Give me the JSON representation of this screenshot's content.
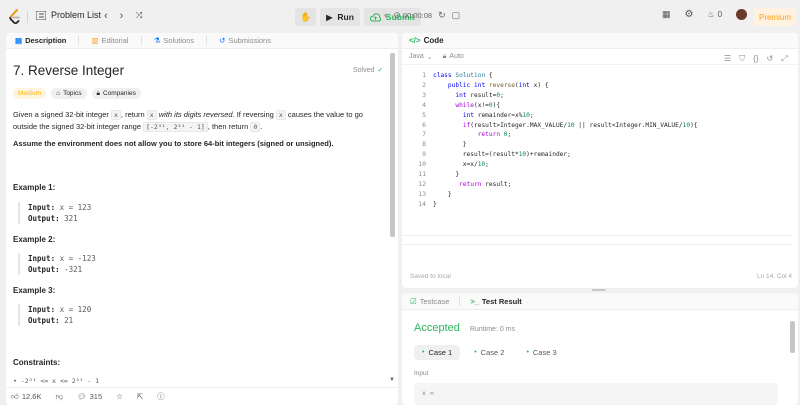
{
  "topbar": {
    "problem_list": "Problem List",
    "run": "Run",
    "submit": "Submit",
    "timer": "00:00:08",
    "coins": "0",
    "premium": "Premium"
  },
  "left_tabs": [
    {
      "label": "Description"
    },
    {
      "label": "Editorial"
    },
    {
      "label": "Solutions"
    },
    {
      "label": "Submissions"
    }
  ],
  "problem": {
    "title": "7. Reverse Integer",
    "solved": "Solved",
    "difficulty": "Medium",
    "topics": "Topics",
    "companies": "Companies",
    "desc_p1a": "Given a signed 32-bit integer ",
    "desc_x": "x",
    "desc_p1b": ", return ",
    "desc_p1c": " with its digits reversed",
    "desc_p1d": ". If reversing ",
    "desc_p1e": " causes the value to go outside the signed 32-bit integer range ",
    "desc_range": "[-2³¹, 2³¹ - 1]",
    "desc_p1f": ", then return ",
    "desc_zero": "0",
    "desc_p1g": ".",
    "assume": "Assume the environment does not allow you to store 64-bit integers (signed or unsigned).",
    "examples": [
      {
        "heading": "Example 1:",
        "input_label": "Input:",
        "input": "x = 123",
        "output_label": "Output:",
        "output": "321"
      },
      {
        "heading": "Example 2:",
        "input_label": "Input:",
        "input": "x = -123",
        "output_label": "Output:",
        "output": "-321"
      },
      {
        "heading": "Example 3:",
        "input_label": "Input:",
        "input": "x = 120",
        "output_label": "Output:",
        "output": "21"
      }
    ],
    "constraints_heading": "Constraints:",
    "constraint_1": "-2³¹ <= x <= 2³¹ - 1"
  },
  "footer": {
    "likes": "12.6K",
    "comments": "315"
  },
  "code_panel": {
    "title": "Code",
    "language": "Java",
    "auto": "Auto",
    "saved": "Saved to local",
    "cursor": "Ln 14, Col 4"
  },
  "code_lines": [
    "1",
    "2",
    "3",
    "4",
    "5",
    "6",
    "7",
    "8",
    "9",
    "10",
    "11",
    "12",
    "13",
    "14"
  ],
  "result_tabs": {
    "testcase": "Testcase",
    "test_result": "Test Result"
  },
  "result": {
    "status": "Accepted",
    "runtime": "Runtime: 0 ms",
    "cases": [
      "Case 1",
      "Case 2",
      "Case 3"
    ],
    "input_label": "Input",
    "input_value": "x ="
  }
}
